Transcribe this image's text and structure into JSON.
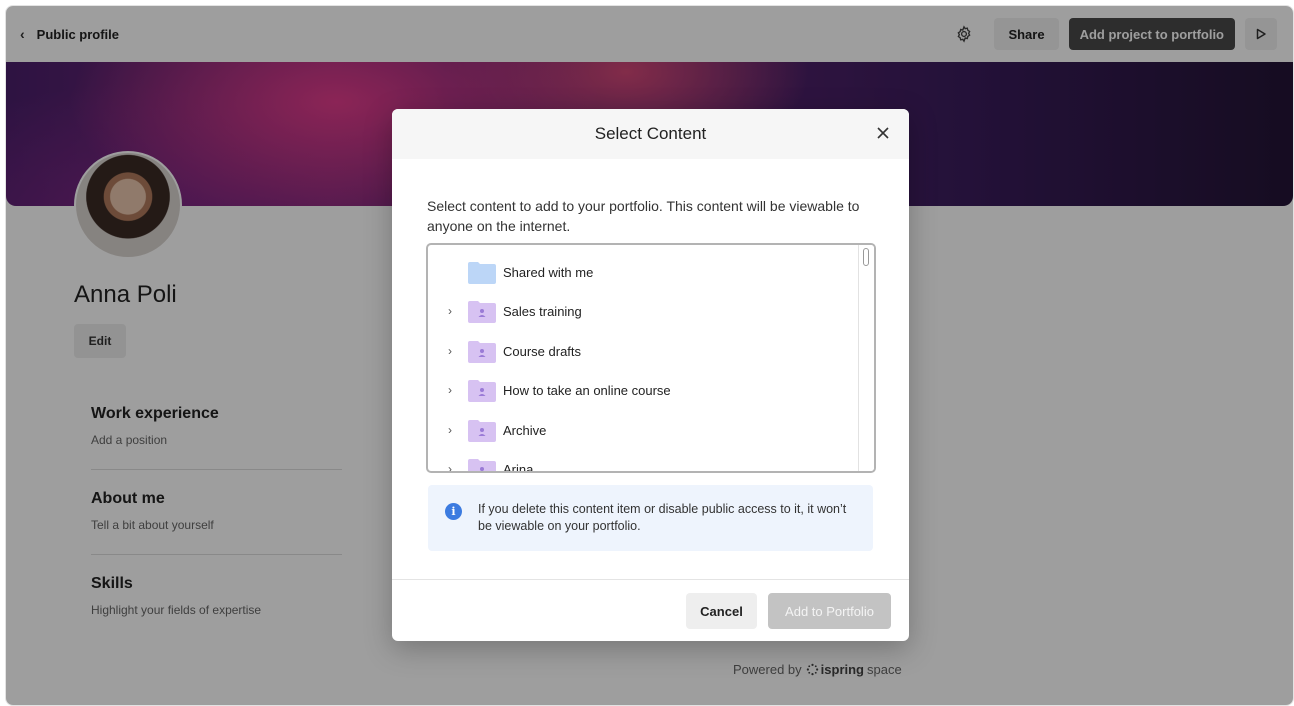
{
  "header": {
    "back_label": "Public profile",
    "share_label": "Share",
    "add_project_label": "Add project to portfolio"
  },
  "profile": {
    "name": "Anna Poli",
    "edit_label": "Edit",
    "sections": [
      {
        "title": "Work experience",
        "subtitle": "Add a position"
      },
      {
        "title": "About me",
        "subtitle": "Tell a bit about yourself"
      },
      {
        "title": "Skills",
        "subtitle": "Highlight your fields of expertise"
      }
    ]
  },
  "footer": {
    "powered_prefix": "Powered by",
    "brand_bold": "ispring",
    "brand_light": "space"
  },
  "modal": {
    "title": "Select Content",
    "description": "Select content to add to your portfolio. This content will be viewable to anyone on the internet.",
    "items": [
      {
        "label": "Shared with me",
        "expandable": false,
        "type": "shared"
      },
      {
        "label": "Sales training",
        "expandable": true,
        "type": "user"
      },
      {
        "label": "Course drafts",
        "expandable": true,
        "type": "user"
      },
      {
        "label": "How to take an online course",
        "expandable": true,
        "type": "user"
      },
      {
        "label": "Archive",
        "expandable": true,
        "type": "user"
      },
      {
        "label": "Arina",
        "expandable": true,
        "type": "user"
      }
    ],
    "notice": "If you delete this content item or disable public access to it, it won’t be viewable on your portfolio.",
    "cancel_label": "Cancel",
    "add_label": "Add to Portfolio"
  },
  "colors": {
    "accent_dark": "#4a4a4a",
    "info_blue": "#3c7be0",
    "folder_shared": "#bcd6f7",
    "folder_user": "#d7c2f2"
  }
}
